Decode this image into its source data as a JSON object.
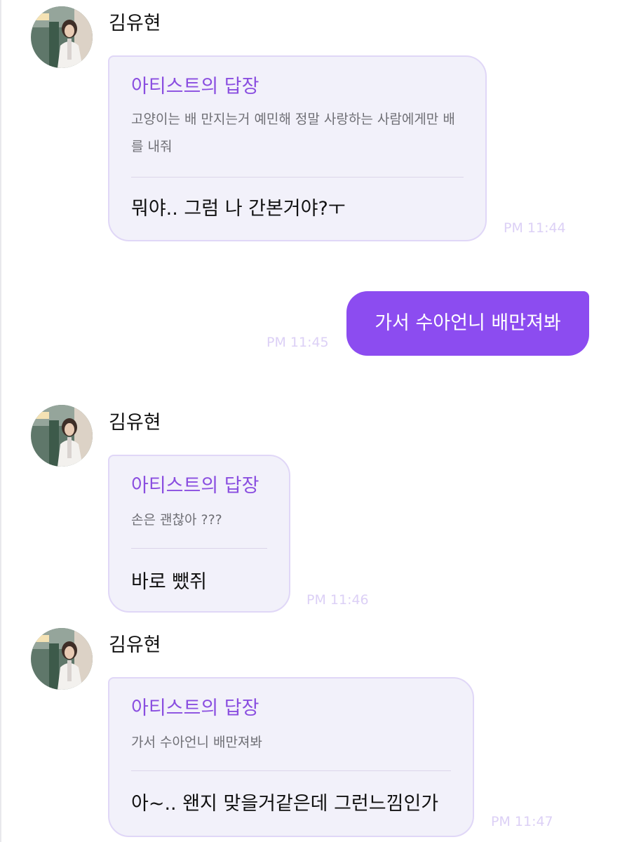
{
  "messages": [
    {
      "sender": "김유현",
      "reply_label": "아티스트의 답장",
      "quoted_text": "고양이는 배 만지는거 예민해 정말 사랑하는 사람에게만 배를 내줘",
      "answer": "뭐야.. 그럼 나 간본거야?ㅜ",
      "time": "PM 11:44"
    },
    {
      "outgoing_text": "가서 수아언니 배만져봐",
      "time": "PM 11:45"
    },
    {
      "sender": "김유현",
      "reply_label": "아티스트의 답장",
      "quoted_text": "손은 괜찮아 ???",
      "answer": "바로 뺐쥐",
      "time": "PM 11:46"
    },
    {
      "sender": "김유현",
      "reply_label": "아티스트의 답장",
      "quoted_text": "가서 수아언니 배만져봐",
      "answer": "아~.. 왠지 맞을거같은데 그런느낌인가",
      "time": "PM 11:47"
    }
  ],
  "colors": {
    "accent": "#8c4cf0",
    "reply_label": "#8a4ee0",
    "card_background": "#f2f1fa",
    "card_border": "#e0d7f7",
    "timestamp": "#dcd0f6"
  },
  "icons": {
    "avatar": "profile-photo"
  }
}
